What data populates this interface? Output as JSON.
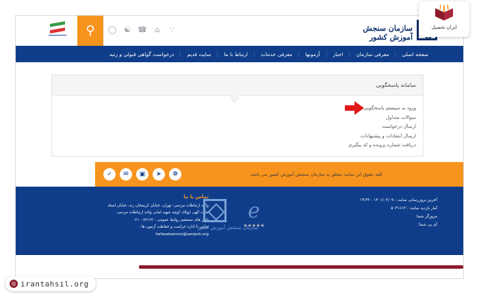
{
  "header": {
    "logo_text": "سازمان سنجش آموزش کشور",
    "search_icon": "search-icon",
    "toolbar_icons": [
      "globe-icon",
      "share-icon",
      "phone-icon",
      "home-icon",
      "rss-icon"
    ]
  },
  "nav": {
    "items": [
      "صفحه اصلی",
      "معرفی سازمان",
      "اخبار",
      "آزمونها",
      "معرفی خدمات",
      "ارتباط با ما",
      "سایت قدیم",
      "درخواست گواهی قبولی و رتبه"
    ]
  },
  "card": {
    "title": "سامانه پاسخگویی",
    "items": [
      "ورود به سیستم پاسخگویی",
      "سوالات متداول",
      "ارسال درخواست",
      "ارسال انتقادات و پیشنهادات",
      "دریافت شماره پرونده و کد پیگیری"
    ]
  },
  "banner": {
    "text": "کلیه حقوق این سایت متعلق به سازمان سنجش آموزش کشور می باشد.",
    "social_icons": [
      "check-icon",
      "mail-icon",
      "instagram-icon",
      "telegram-icon",
      "aparat-icon"
    ]
  },
  "footer": {
    "contact_title": "تماس با ما",
    "contact_lines": [
      "واحد ارتباطات مردمی: تهران، خیابان کریمخان زند، خیابان استاد",
      "نجات الهی (ویلا)، کوچه شهید امانی واحد ارتباطات مردمی",
      "تلفن های مستقیم روابط عمومی : ۸۲۱۶۳ - ۰۲۱",
      "تماس با اداره حراست و حفاظت آزمون ها :",
      "hefazatazmon@sanjesh.org"
    ],
    "logo_caption": "سازمان سنجش آموزش کشور",
    "stats": [
      "آخرین بروزرسانی سایت : ۱۴۰۱/۰۲/۰۹ - ۱۹:۴۲",
      "آمار بازدید سایت : ۵۰۳۱۶۱۳",
      "مرورگر شما:",
      "آی پی شما:"
    ]
  },
  "watermark": {
    "site": "irantahsil.org",
    "corner_label": "ایران تحصیل"
  },
  "colors": {
    "nav_blue": "#0f3d8a",
    "orange": "#f7941d",
    "brand_red": "#8b1a2b"
  }
}
